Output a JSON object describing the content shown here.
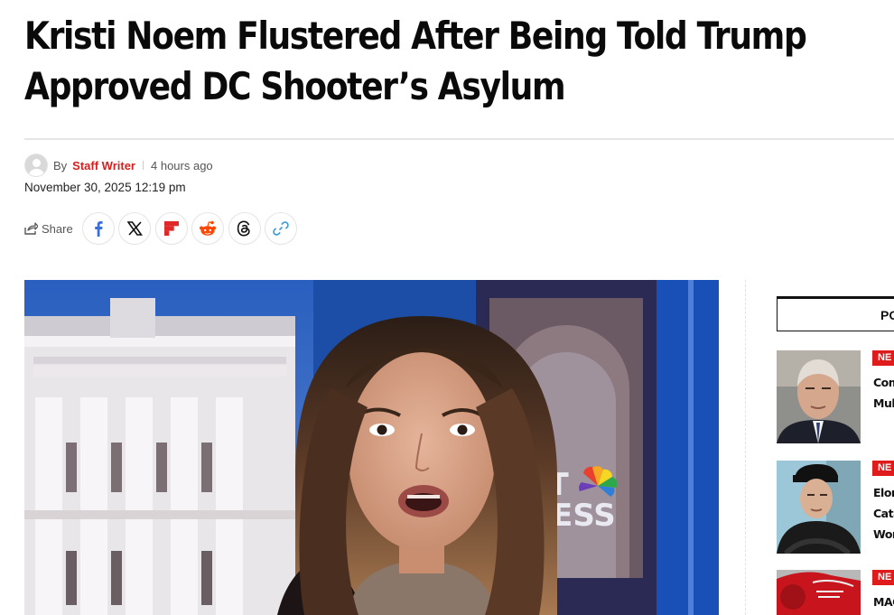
{
  "article": {
    "headline_line1": "Kristi Noem Flustered After Being Told Trump",
    "headline_line2": "Approved DC Shooter’s Asylum",
    "by_label": "By",
    "author": "Staff Writer",
    "relative_time": "4 hours ago",
    "date": "November 30, 2025 12:19 pm"
  },
  "share": {
    "label": "Share",
    "buttons": [
      "facebook-icon",
      "x-icon",
      "flipboard-icon",
      "reddit-icon",
      "threads-icon",
      "link-icon"
    ]
  },
  "hero_image": {
    "overlay_line1": "EET",
    "overlay_line2": "PRESS"
  },
  "sidebar": {
    "popular_title": "PO",
    "items": [
      {
        "badge": "NE",
        "title": "Com\nMult"
      },
      {
        "badge": "NE",
        "title": "Elon\nCata\nWor"
      },
      {
        "badge": "NE",
        "title": "MAC"
      }
    ]
  },
  "colors": {
    "accent_red": "#d61f1f",
    "badge_red": "#e01b1b",
    "hero_blue": "#1b3f86"
  }
}
